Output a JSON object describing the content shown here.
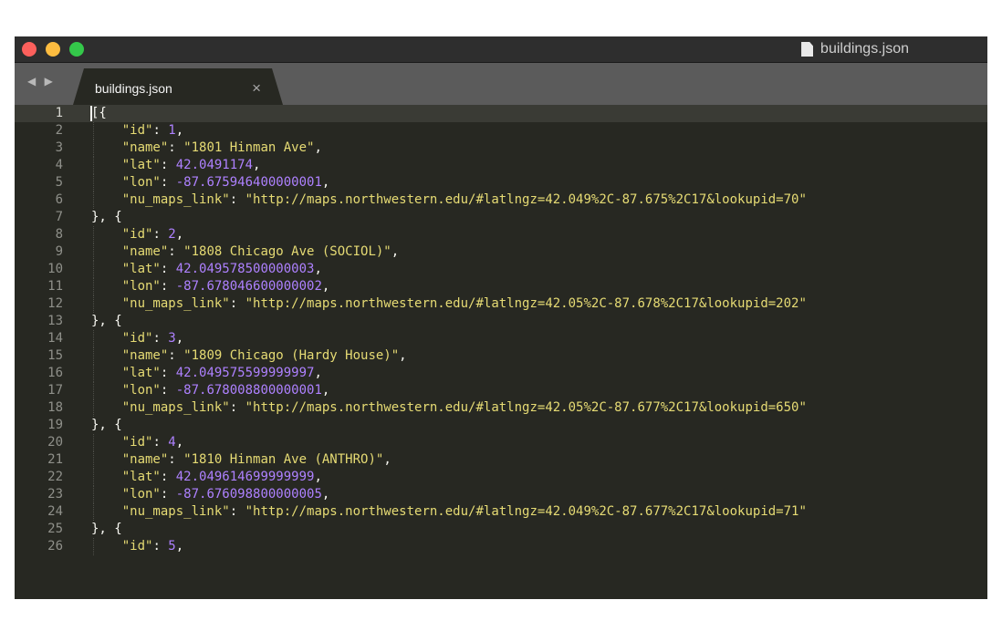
{
  "window": {
    "title": "buildings.json"
  },
  "tab": {
    "label": "buildings.json",
    "close_glyph": "×",
    "nav_glyph": "◀ ▶"
  },
  "colors": {
    "background": "#272822",
    "key": "#e6db74",
    "number": "#ae81ff",
    "punctuation": "#f8f8f2",
    "line_number": "#8f908a"
  },
  "editor": {
    "active_line": 1,
    "lines": [
      {
        "num": "1",
        "indent": "",
        "tokens": [
          {
            "t": "[{",
            "c": "p"
          }
        ]
      },
      {
        "num": "2",
        "indent": "    ",
        "tokens": [
          {
            "t": "\"id\"",
            "c": "k"
          },
          {
            "t": ": ",
            "c": "p"
          },
          {
            "t": "1",
            "c": "n"
          },
          {
            "t": ",",
            "c": "p"
          }
        ]
      },
      {
        "num": "3",
        "indent": "    ",
        "tokens": [
          {
            "t": "\"name\"",
            "c": "k"
          },
          {
            "t": ": ",
            "c": "p"
          },
          {
            "t": "\"1801 Hinman Ave\"",
            "c": "s"
          },
          {
            "t": ",",
            "c": "p"
          }
        ]
      },
      {
        "num": "4",
        "indent": "    ",
        "tokens": [
          {
            "t": "\"lat\"",
            "c": "k"
          },
          {
            "t": ": ",
            "c": "p"
          },
          {
            "t": "42.0491174",
            "c": "n"
          },
          {
            "t": ",",
            "c": "p"
          }
        ]
      },
      {
        "num": "5",
        "indent": "    ",
        "tokens": [
          {
            "t": "\"lon\"",
            "c": "k"
          },
          {
            "t": ": ",
            "c": "p"
          },
          {
            "t": "-87.675946400000001",
            "c": "n"
          },
          {
            "t": ",",
            "c": "p"
          }
        ]
      },
      {
        "num": "6",
        "indent": "    ",
        "tokens": [
          {
            "t": "\"nu_maps_link\"",
            "c": "k"
          },
          {
            "t": ": ",
            "c": "p"
          },
          {
            "t": "\"http://maps.northwestern.edu/#latlngz=42.049%2C-87.675%2C17&lookupid=70\"",
            "c": "s"
          }
        ]
      },
      {
        "num": "7",
        "indent": "",
        "tokens": [
          {
            "t": "}, {",
            "c": "p"
          }
        ]
      },
      {
        "num": "8",
        "indent": "    ",
        "tokens": [
          {
            "t": "\"id\"",
            "c": "k"
          },
          {
            "t": ": ",
            "c": "p"
          },
          {
            "t": "2",
            "c": "n"
          },
          {
            "t": ",",
            "c": "p"
          }
        ]
      },
      {
        "num": "9",
        "indent": "    ",
        "tokens": [
          {
            "t": "\"name\"",
            "c": "k"
          },
          {
            "t": ": ",
            "c": "p"
          },
          {
            "t": "\"1808 Chicago Ave (SOCIOL)\"",
            "c": "s"
          },
          {
            "t": ",",
            "c": "p"
          }
        ]
      },
      {
        "num": "10",
        "indent": "    ",
        "tokens": [
          {
            "t": "\"lat\"",
            "c": "k"
          },
          {
            "t": ": ",
            "c": "p"
          },
          {
            "t": "42.049578500000003",
            "c": "n"
          },
          {
            "t": ",",
            "c": "p"
          }
        ]
      },
      {
        "num": "11",
        "indent": "    ",
        "tokens": [
          {
            "t": "\"lon\"",
            "c": "k"
          },
          {
            "t": ": ",
            "c": "p"
          },
          {
            "t": "-87.678046600000002",
            "c": "n"
          },
          {
            "t": ",",
            "c": "p"
          }
        ]
      },
      {
        "num": "12",
        "indent": "    ",
        "tokens": [
          {
            "t": "\"nu_maps_link\"",
            "c": "k"
          },
          {
            "t": ": ",
            "c": "p"
          },
          {
            "t": "\"http://maps.northwestern.edu/#latlngz=42.05%2C-87.678%2C17&lookupid=202\"",
            "c": "s"
          }
        ]
      },
      {
        "num": "13",
        "indent": "",
        "tokens": [
          {
            "t": "}, {",
            "c": "p"
          }
        ]
      },
      {
        "num": "14",
        "indent": "    ",
        "tokens": [
          {
            "t": "\"id\"",
            "c": "k"
          },
          {
            "t": ": ",
            "c": "p"
          },
          {
            "t": "3",
            "c": "n"
          },
          {
            "t": ",",
            "c": "p"
          }
        ]
      },
      {
        "num": "15",
        "indent": "    ",
        "tokens": [
          {
            "t": "\"name\"",
            "c": "k"
          },
          {
            "t": ": ",
            "c": "p"
          },
          {
            "t": "\"1809 Chicago (Hardy House)\"",
            "c": "s"
          },
          {
            "t": ",",
            "c": "p"
          }
        ]
      },
      {
        "num": "16",
        "indent": "    ",
        "tokens": [
          {
            "t": "\"lat\"",
            "c": "k"
          },
          {
            "t": ": ",
            "c": "p"
          },
          {
            "t": "42.049575599999997",
            "c": "n"
          },
          {
            "t": ",",
            "c": "p"
          }
        ]
      },
      {
        "num": "17",
        "indent": "    ",
        "tokens": [
          {
            "t": "\"lon\"",
            "c": "k"
          },
          {
            "t": ": ",
            "c": "p"
          },
          {
            "t": "-87.678008800000001",
            "c": "n"
          },
          {
            "t": ",",
            "c": "p"
          }
        ]
      },
      {
        "num": "18",
        "indent": "    ",
        "tokens": [
          {
            "t": "\"nu_maps_link\"",
            "c": "k"
          },
          {
            "t": ": ",
            "c": "p"
          },
          {
            "t": "\"http://maps.northwestern.edu/#latlngz=42.05%2C-87.677%2C17&lookupid=650\"",
            "c": "s"
          }
        ]
      },
      {
        "num": "19",
        "indent": "",
        "tokens": [
          {
            "t": "}, {",
            "c": "p"
          }
        ]
      },
      {
        "num": "20",
        "indent": "    ",
        "tokens": [
          {
            "t": "\"id\"",
            "c": "k"
          },
          {
            "t": ": ",
            "c": "p"
          },
          {
            "t": "4",
            "c": "n"
          },
          {
            "t": ",",
            "c": "p"
          }
        ]
      },
      {
        "num": "21",
        "indent": "    ",
        "tokens": [
          {
            "t": "\"name\"",
            "c": "k"
          },
          {
            "t": ": ",
            "c": "p"
          },
          {
            "t": "\"1810 Hinman Ave (ANTHRO)\"",
            "c": "s"
          },
          {
            "t": ",",
            "c": "p"
          }
        ]
      },
      {
        "num": "22",
        "indent": "    ",
        "tokens": [
          {
            "t": "\"lat\"",
            "c": "k"
          },
          {
            "t": ": ",
            "c": "p"
          },
          {
            "t": "42.049614699999999",
            "c": "n"
          },
          {
            "t": ",",
            "c": "p"
          }
        ]
      },
      {
        "num": "23",
        "indent": "    ",
        "tokens": [
          {
            "t": "\"lon\"",
            "c": "k"
          },
          {
            "t": ": ",
            "c": "p"
          },
          {
            "t": "-87.676098800000005",
            "c": "n"
          },
          {
            "t": ",",
            "c": "p"
          }
        ]
      },
      {
        "num": "24",
        "indent": "    ",
        "tokens": [
          {
            "t": "\"nu_maps_link\"",
            "c": "k"
          },
          {
            "t": ": ",
            "c": "p"
          },
          {
            "t": "\"http://maps.northwestern.edu/#latlngz=42.049%2C-87.677%2C17&lookupid=71\"",
            "c": "s"
          }
        ]
      },
      {
        "num": "25",
        "indent": "",
        "tokens": [
          {
            "t": "}, {",
            "c": "p"
          }
        ]
      },
      {
        "num": "26",
        "indent": "    ",
        "tokens": [
          {
            "t": "\"id\"",
            "c": "k"
          },
          {
            "t": ": ",
            "c": "p"
          },
          {
            "t": "5",
            "c": "n"
          },
          {
            "t": ",",
            "c": "p"
          }
        ]
      }
    ]
  }
}
